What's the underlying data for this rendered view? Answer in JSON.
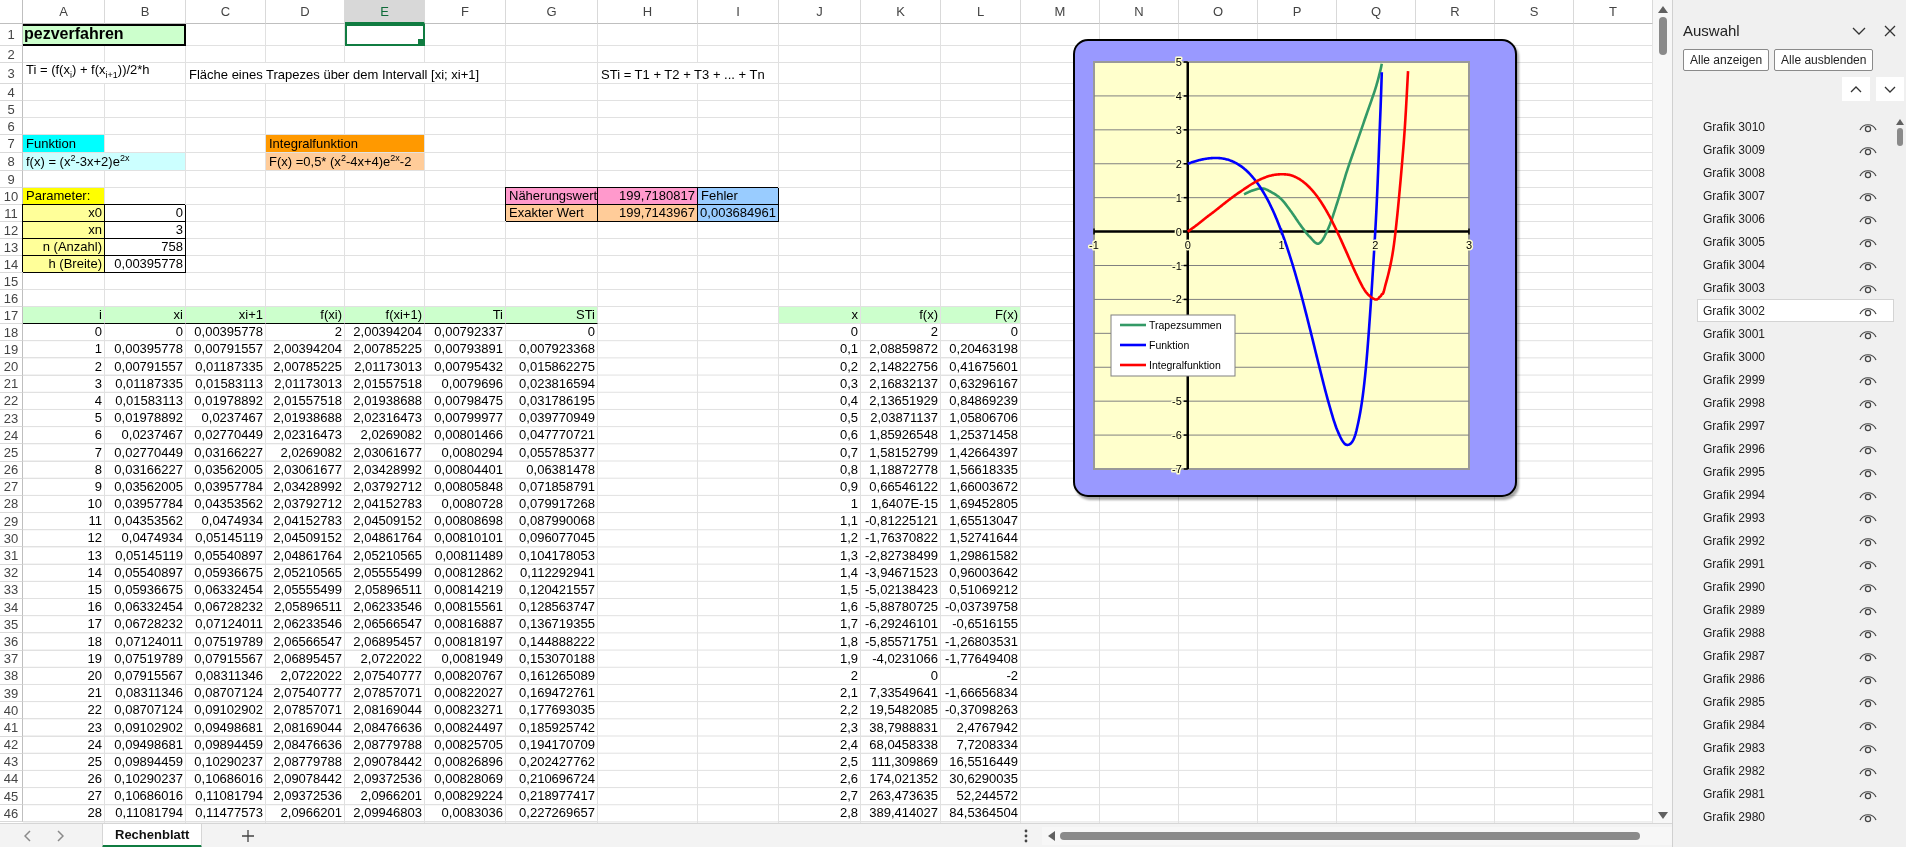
{
  "sheet": {
    "columns": [
      {
        "label": "A",
        "selected": false
      },
      {
        "label": "B",
        "selected": false
      },
      {
        "label": "C",
        "selected": false
      },
      {
        "label": "D",
        "selected": false
      },
      {
        "label": "E",
        "selected": true
      },
      {
        "label": "F",
        "selected": false
      },
      {
        "label": "G",
        "selected": false
      },
      {
        "label": "H",
        "selected": false
      },
      {
        "label": "I",
        "selected": false
      },
      {
        "label": "J",
        "selected": false
      },
      {
        "label": "K",
        "selected": false
      },
      {
        "label": "L",
        "selected": false
      },
      {
        "label": "M",
        "selected": false
      },
      {
        "label": "N",
        "selected": false
      },
      {
        "label": "O",
        "selected": false
      },
      {
        "label": "P",
        "selected": false
      },
      {
        "label": "Q",
        "selected": false
      },
      {
        "label": "R",
        "selected": false
      },
      {
        "label": "S",
        "selected": false
      },
      {
        "label": "T",
        "selected": false
      }
    ],
    "rows": [
      {
        "number": "1",
        "cells": [
          {
            "kind": "title",
            "text": "pezverfahren",
            "color": "#ccffcc"
          },
          null,
          null,
          null,
          {
            "kind": "blank",
            "selected": true
          }
        ]
      },
      {
        "number": "2"
      },
      {
        "number": "3",
        "cells": [
          {
            "kind": "text",
            "text": "Ti = (f(x$_{i}$) + f(x$_{i+1}$))/2*h"
          },
          null,
          {
            "kind": "text",
            "text": "Fläche eines Trapezes über dem Intervall [xi; xi+1]"
          },
          null,
          null,
          null,
          null,
          {
            "kind": "text",
            "text": "STi = T1 + T2 + T3 + ... + Tn"
          }
        ]
      },
      {
        "number": "4"
      },
      {
        "number": "5"
      },
      {
        "number": "6"
      },
      {
        "number": "7",
        "cells": [
          {
            "kind": "text",
            "text": "Funktion",
            "color": "#00ffff"
          },
          null,
          null,
          {
            "kind": "text",
            "text": "Integralfunktion",
            "color": "#ff9900"
          }
        ]
      },
      {
        "number": "8",
        "cells": [
          {
            "kind": "text",
            "text": "f(x) = (x$^{2}$-3x+2)e$^{2x}$",
            "color": "#ccffff"
          },
          null,
          null,
          {
            "kind": "text",
            "text": "F(x) =0,5* (x$^{2}$-4x+4)e$^{2x}$-2",
            "color": "#ffcc99"
          }
        ]
      },
      {
        "number": "9"
      },
      {
        "number": "10",
        "cells": [
          {
            "kind": "text",
            "text": "Parameter:",
            "color": "#ffff00"
          },
          null,
          null,
          null,
          null,
          null,
          {
            "kind": "text",
            "text": "Näherungswert",
            "color": "#ff99cc",
            "boxed": true
          },
          {
            "kind": "number",
            "text": "199,7180817",
            "color": "#ff99cc",
            "boxed": true
          },
          {
            "kind": "text",
            "text": "Fehler",
            "color": "#99ccff",
            "boxed": true
          }
        ]
      },
      {
        "number": "11",
        "cells": [
          {
            "kind": "label",
            "text": "x0",
            "color": "#ffff99",
            "boxed": true
          },
          {
            "kind": "number",
            "text": "0",
            "boxed": true
          },
          null,
          null,
          null,
          null,
          {
            "kind": "text",
            "text": "Exakter Wert",
            "color": "#ffcc99",
            "boxed": true
          },
          {
            "kind": "number",
            "text": "199,7143967",
            "color": "#ffcc99",
            "boxed": true
          },
          {
            "kind": "number",
            "text": "0,003684961",
            "color": "#99ccff",
            "boxed": true
          }
        ]
      },
      {
        "number": "12",
        "cells": [
          {
            "kind": "label",
            "text": "xn",
            "color": "#ffff99",
            "boxed": true
          },
          {
            "kind": "number",
            "text": "3",
            "boxed": true
          }
        ]
      },
      {
        "number": "13",
        "cells": [
          {
            "kind": "label",
            "text": "n (Anzahl)",
            "color": "#ffff99",
            "boxed": true
          },
          {
            "kind": "number",
            "text": "758",
            "boxed": true
          }
        ]
      },
      {
        "number": "14",
        "cells": [
          {
            "kind": "label",
            "text": "h (Breite)",
            "color": "#ffff99",
            "boxed": true
          },
          {
            "kind": "number",
            "text": "0,00395778",
            "boxed": true
          }
        ]
      },
      {
        "number": "15"
      },
      {
        "number": "16"
      },
      {
        "number": "17",
        "cells": [
          {
            "kind": "heading",
            "text": "i",
            "color": "#ccffcc",
            "rule": true
          },
          {
            "kind": "heading",
            "text": "xi",
            "color": "#ccffcc",
            "rule": true
          },
          {
            "kind": "heading",
            "text": "xi+1",
            "color": "#ccffcc",
            "rule": true
          },
          {
            "kind": "heading",
            "text": "f(xi)",
            "color": "#ccffcc",
            "rule": true
          },
          {
            "kind": "heading",
            "text": "f(xi+1)",
            "color": "#ccffcc",
            "rule": true
          },
          {
            "kind": "heading",
            "text": "Ti",
            "color": "#ccffcc",
            "rule": true
          },
          {
            "kind": "heading",
            "text": "STi",
            "color": "#ccffcc",
            "rule": true
          },
          null,
          null,
          {
            "kind": "heading",
            "text": "x",
            "color": "#ccffcc"
          },
          {
            "kind": "heading",
            "text": "f(x)",
            "color": "#ccffcc"
          },
          {
            "kind": "heading",
            "text": "F(x)",
            "color": "#ccffcc"
          }
        ]
      },
      {
        "number": "18",
        "cells": [
          "0",
          "0",
          "0,00395778",
          "2",
          "2,00394204",
          "0,00792337",
          "0",
          null,
          null,
          "0",
          "2",
          "0"
        ]
      },
      {
        "number": "19",
        "cells": [
          "1",
          "0,00395778",
          "0,00791557",
          "2,00394204",
          "2,00785225",
          "0,00793891",
          "0,007923368",
          null,
          null,
          "0,1",
          "2,08859872",
          "0,20463198"
        ]
      },
      {
        "number": "20",
        "cells": [
          "2",
          "0,00791557",
          "0,01187335",
          "2,00785225",
          "2,01173013",
          "0,00795432",
          "0,015862275",
          null,
          null,
          "0,2",
          "2,14822756",
          "0,41675601"
        ]
      },
      {
        "number": "21",
        "cells": [
          "3",
          "0,01187335",
          "0,01583113",
          "2,01173013",
          "2,01557518",
          "0,0079696",
          "0,023816594",
          null,
          null,
          "0,3",
          "2,16832137",
          "0,63296167"
        ]
      },
      {
        "number": "22",
        "cells": [
          "4",
          "0,01583113",
          "0,01978892",
          "2,01557518",
          "2,01938688",
          "0,00798475",
          "0,031786195",
          null,
          null,
          "0,4",
          "2,13651929",
          "0,84869239"
        ]
      },
      {
        "number": "23",
        "cells": [
          "5",
          "0,01978892",
          "0,0237467",
          "2,01938688",
          "2,02316473",
          "0,00799977",
          "0,039770949",
          null,
          null,
          "0,5",
          "2,03871137",
          "1,05806706"
        ]
      },
      {
        "number": "24",
        "cells": [
          "6",
          "0,0237467",
          "0,02770449",
          "2,02316473",
          "2,0269082",
          "0,00801466",
          "0,047770721",
          null,
          null,
          "0,6",
          "1,85926548",
          "1,25371458"
        ]
      },
      {
        "number": "25",
        "cells": [
          "7",
          "0,02770449",
          "0,03166227",
          "2,0269082",
          "2,03061677",
          "0,0080294",
          "0,055785377",
          null,
          null,
          "0,7",
          "1,58152799",
          "1,42664397"
        ]
      },
      {
        "number": "26",
        "cells": [
          "8",
          "0,03166227",
          "0,03562005",
          "2,03061677",
          "2,03428992",
          "0,00804401",
          "0,06381478",
          null,
          null,
          "0,8",
          "1,18872778",
          "1,56618335"
        ]
      },
      {
        "number": "27",
        "cells": [
          "9",
          "0,03562005",
          "0,03957784",
          "2,03428992",
          "2,03792712",
          "0,00805848",
          "0,071858791",
          null,
          null,
          "0,9",
          "0,66546122",
          "1,66003672"
        ]
      },
      {
        "number": "28",
        "cells": [
          "10",
          "0,03957784",
          "0,04353562",
          "2,03792712",
          "2,04152783",
          "0,0080728",
          "0,079917268",
          null,
          null,
          "1",
          "1,6407E-15",
          "1,69452805"
        ]
      },
      {
        "number": "29",
        "cells": [
          "11",
          "0,04353562",
          "0,0474934",
          "2,04152783",
          "2,04509152",
          "0,00808698",
          "0,087990068",
          null,
          null,
          "1,1",
          "-0,81225121",
          "1,65513047"
        ]
      },
      {
        "number": "30",
        "cells": [
          "12",
          "0,0474934",
          "0,05145119",
          "2,04509152",
          "2,04861764",
          "0,00810101",
          "0,096077045",
          null,
          null,
          "1,2",
          "-1,76370822",
          "1,52741644"
        ]
      },
      {
        "number": "31",
        "cells": [
          "13",
          "0,05145119",
          "0,05540897",
          "2,04861764",
          "2,05210565",
          "0,00811489",
          "0,104178053",
          null,
          null,
          "1,3",
          "-2,82738499",
          "1,29861582"
        ]
      },
      {
        "number": "32",
        "cells": [
          "14",
          "0,05540897",
          "0,05936675",
          "2,05210565",
          "2,05555499",
          "0,00812862",
          "0,112292941",
          null,
          null,
          "1,4",
          "-3,94671523",
          "0,96003642"
        ]
      },
      {
        "number": "33",
        "cells": [
          "15",
          "0,05936675",
          "0,06332454",
          "2,05555499",
          "2,05896511",
          "0,00814219",
          "0,120421557",
          null,
          null,
          "1,5",
          "-5,02138423",
          "0,51069212"
        ]
      },
      {
        "number": "34",
        "cells": [
          "16",
          "0,06332454",
          "0,06728232",
          "2,05896511",
          "2,06233546",
          "0,00815561",
          "0,128563747",
          null,
          null,
          "1,6",
          "-5,88780725",
          "-0,03739758"
        ]
      },
      {
        "number": "35",
        "cells": [
          "17",
          "0,06728232",
          "0,07124011",
          "2,06233546",
          "2,06566547",
          "0,00816887",
          "0,136719355",
          null,
          null,
          "1,7",
          "-6,29246101",
          "-0,6516155"
        ]
      },
      {
        "number": "36",
        "cells": [
          "18",
          "0,07124011",
          "0,07519789",
          "2,06566547",
          "2,06895457",
          "0,00818197",
          "0,144888222",
          null,
          null,
          "1,8",
          "-5,85571751",
          "-1,26803531"
        ]
      },
      {
        "number": "37",
        "cells": [
          "19",
          "0,07519789",
          "0,07915567",
          "2,06895457",
          "2,0722022",
          "0,0081949",
          "0,153070188",
          null,
          null,
          "1,9",
          "-4,0231066",
          "-1,77649408"
        ]
      },
      {
        "number": "38",
        "cells": [
          "20",
          "0,07915567",
          "0,08311346",
          "2,0722022",
          "2,07540777",
          "0,00820767",
          "0,161265089",
          null,
          null,
          "2",
          "0",
          "-2"
        ]
      },
      {
        "number": "39",
        "cells": [
          "21",
          "0,08311346",
          "0,08707124",
          "2,07540777",
          "2,07857071",
          "0,00822027",
          "0,169472761",
          null,
          null,
          "2,1",
          "7,33549641",
          "-1,66656834"
        ]
      },
      {
        "number": "40",
        "cells": [
          "22",
          "0,08707124",
          "0,09102902",
          "2,07857071",
          "2,08169044",
          "0,00823271",
          "0,177693035",
          null,
          null,
          "2,2",
          "19,5482085",
          "-0,37098263"
        ]
      },
      {
        "number": "41",
        "cells": [
          "23",
          "0,09102902",
          "0,09498681",
          "2,08169044",
          "2,08476636",
          "0,00824497",
          "0,185925742",
          null,
          null,
          "2,3",
          "38,7988831",
          "2,4767942"
        ]
      },
      {
        "number": "42",
        "cells": [
          "24",
          "0,09498681",
          "0,09894459",
          "2,08476636",
          "2,08779788",
          "0,00825705",
          "0,194170709",
          null,
          null,
          "2,4",
          "68,0458338",
          "7,7208334"
        ]
      },
      {
        "number": "43",
        "cells": [
          "25",
          "0,09894459",
          "0,10290237",
          "2,08779788",
          "2,09078442",
          "0,00826896",
          "0,202427762",
          null,
          null,
          "2,5",
          "111,309869",
          "16,5516449"
        ]
      },
      {
        "number": "44",
        "cells": [
          "26",
          "0,10290237",
          "0,10686016",
          "2,09078442",
          "2,09372536",
          "0,00828069",
          "0,210696724",
          null,
          null,
          "2,6",
          "174,021352",
          "30,6290035"
        ]
      },
      {
        "number": "45",
        "cells": [
          "27",
          "0,10686016",
          "0,11081794",
          "2,09372536",
          "2,0966201",
          "0,00829224",
          "0,218977417",
          null,
          null,
          "2,7",
          "263,473635",
          "52,244572"
        ]
      },
      {
        "number": "46",
        "cells": [
          "28",
          "0,11081794",
          "0,11477573",
          "2,0966201",
          "2,09946803",
          "0,0083036",
          "0,227269657",
          null,
          null,
          "2,8",
          "389,414027",
          "84,5364504"
        ]
      }
    ]
  },
  "chart": {
    "chart_data": {
      "type": "line",
      "x": [
        0,
        0.1,
        0.2,
        0.3,
        0.4,
        0.5,
        0.6,
        0.7,
        0.8,
        0.9,
        1,
        1.1,
        1.2,
        1.3,
        1.4,
        1.5,
        1.6,
        1.7,
        1.8,
        1.9,
        2,
        2.05,
        2.07,
        2.1,
        2.2,
        2.3,
        2.35
      ],
      "grid": true,
      "legend": true,
      "series": [
        {
          "name": "Trapezsummen",
          "color": "#339966",
          "values": [
            null,
            null,
            null,
            null,
            null,
            null,
            1.1,
            1.22,
            1.27,
            1.15,
            0.95,
            0.6,
            0.2,
            -0.15,
            -0.35,
            0.1,
            0.9,
            1.8,
            2.6,
            3.4,
            4.2,
            4.7,
            4.95,
            null,
            null,
            null,
            null
          ]
        },
        {
          "name": "Funktion",
          "color": "#0000ff",
          "values": [
            2,
            2.09,
            2.15,
            2.17,
            2.14,
            2.04,
            1.86,
            1.58,
            1.19,
            0.67,
            0,
            -0.81,
            -1.76,
            -2.83,
            -3.95,
            -5.02,
            -5.89,
            -6.29,
            -5.86,
            -4.02,
            0,
            3.17,
            4.7,
            null,
            null,
            null,
            null
          ]
        },
        {
          "name": "Integralfunktion",
          "color": "#ff0000",
          "values": [
            0,
            0.2,
            0.42,
            0.63,
            0.85,
            1.06,
            1.25,
            1.43,
            1.57,
            1.66,
            1.69,
            1.66,
            1.53,
            1.3,
            0.96,
            0.51,
            -0.04,
            -0.65,
            -1.27,
            -1.78,
            -2,
            -1.92,
            -1.85,
            -1.67,
            -0.37,
            2.48,
            4.73
          ]
        }
      ],
      "xlim": [
        -1,
        3
      ],
      "ylim": [
        -7,
        5
      ],
      "xticks": [
        -1,
        0,
        1,
        2,
        3
      ],
      "yticks": [
        5,
        4,
        3,
        2,
        1,
        0,
        -1,
        -2,
        -5,
        -6,
        -7
      ]
    }
  },
  "sheet_tabs": [
    {
      "label": "Rechenblatt",
      "selected": true
    }
  ],
  "selection_pane": {
    "title": "Auswahl",
    "buttons": [
      "Alle anzeigen",
      "Alle ausblenden"
    ],
    "items": [
      {
        "label": "Grafik 3010",
        "visible": true,
        "selected": false
      },
      {
        "label": "Grafik 3009",
        "visible": true,
        "selected": false
      },
      {
        "label": "Grafik 3008",
        "visible": true,
        "selected": false
      },
      {
        "label": "Grafik 3007",
        "visible": true,
        "selected": false
      },
      {
        "label": "Grafik 3006",
        "visible": true,
        "selected": false
      },
      {
        "label": "Grafik 3005",
        "visible": true,
        "selected": false
      },
      {
        "label": "Grafik 3004",
        "visible": true,
        "selected": false
      },
      {
        "label": "Grafik 3003",
        "visible": true,
        "selected": false
      },
      {
        "label": "Grafik 3002",
        "visible": true,
        "selected": true
      },
      {
        "label": "Grafik 3001",
        "visible": true,
        "selected": false
      },
      {
        "label": "Grafik 3000",
        "visible": true,
        "selected": false
      },
      {
        "label": "Grafik 2999",
        "visible": true,
        "selected": false
      },
      {
        "label": "Grafik 2998",
        "visible": true,
        "selected": false
      },
      {
        "label": "Grafik 2997",
        "visible": true,
        "selected": false
      },
      {
        "label": "Grafik 2996",
        "visible": true,
        "selected": false
      },
      {
        "label": "Grafik 2995",
        "visible": true,
        "selected": false
      },
      {
        "label": "Grafik 2994",
        "visible": true,
        "selected": false
      },
      {
        "label": "Grafik 2993",
        "visible": true,
        "selected": false
      },
      {
        "label": "Grafik 2992",
        "visible": true,
        "selected": false
      },
      {
        "label": "Grafik 2991",
        "visible": true,
        "selected": false
      },
      {
        "label": "Grafik 2990",
        "visible": true,
        "selected": false
      },
      {
        "label": "Grafik 2989",
        "visible": true,
        "selected": false
      },
      {
        "label": "Grafik 2988",
        "visible": true,
        "selected": false
      },
      {
        "label": "Grafik 2987",
        "visible": true,
        "selected": false
      },
      {
        "label": "Grafik 2986",
        "visible": true,
        "selected": false
      },
      {
        "label": "Grafik 2985",
        "visible": true,
        "selected": false
      },
      {
        "label": "Grafik 2984",
        "visible": true,
        "selected": false
      },
      {
        "label": "Grafik 2983",
        "visible": true,
        "selected": false
      },
      {
        "label": "Grafik 2982",
        "visible": true,
        "selected": false
      },
      {
        "label": "Grafik 2981",
        "visible": true,
        "selected": false
      },
      {
        "label": "Grafik 2980",
        "visible": true,
        "selected": false
      }
    ]
  }
}
